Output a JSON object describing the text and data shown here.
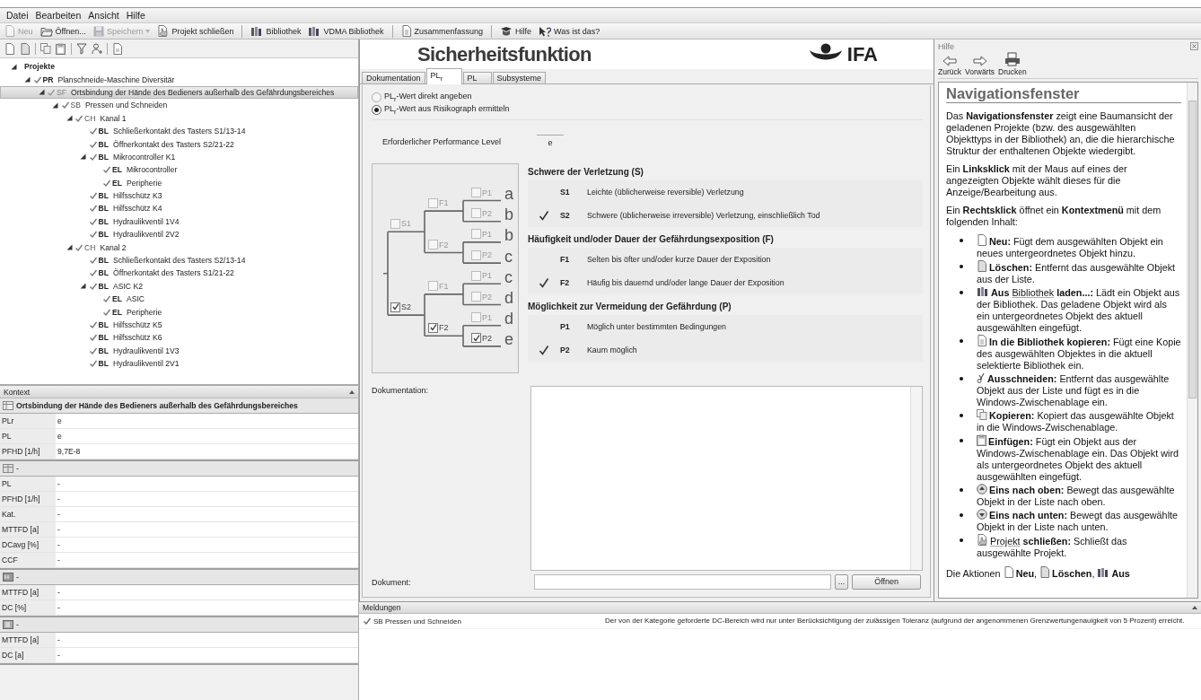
{
  "menu": [
    "Datei",
    "Bearbeiten",
    "Ansicht",
    "Hilfe"
  ],
  "toolbar": [
    {
      "kind": "button",
      "label": "Neu",
      "disabled": true
    },
    {
      "kind": "button",
      "label": "Öffnen...",
      "disabled": false
    },
    {
      "kind": "split_button",
      "label": "Speichern",
      "disabled": true
    },
    {
      "kind": "button",
      "label": "Projekt schließen",
      "disabled": false
    },
    {
      "kind": "separator"
    },
    {
      "kind": "button",
      "label": "Bibliothek",
      "disabled": false
    },
    {
      "kind": "button",
      "label": "VDMA Bibliothek",
      "disabled": false
    },
    {
      "kind": "separator"
    },
    {
      "kind": "button",
      "label": "Zusammenfassung",
      "disabled": false
    },
    {
      "kind": "separator"
    },
    {
      "kind": "button",
      "label": "Hilfe",
      "disabled": false
    },
    {
      "kind": "button",
      "label": "Was ist das?",
      "disabled": false
    }
  ],
  "tree": {
    "title": "Projekte",
    "expanded": true,
    "nodes": [
      {
        "kind": "project",
        "tag": "PR",
        "label": "Planschneide-Maschine Diversitär",
        "valid": true,
        "selected": false,
        "expanded": true,
        "children": [
          {
            "kind": "function",
            "tag": "SF",
            "label": "Ortsbindung der Hände des Bedieners außerhalb des Gefährdungsbereiches",
            "valid": true,
            "selected": true,
            "expanded": true,
            "children": [
              {
                "kind": "subsystem",
                "tag": "SB",
                "label": "Pressen und Schneiden",
                "valid": true,
                "selected": false,
                "expanded": true,
                "children": [
                  {
                    "kind": "channel",
                    "tag": "CH",
                    "label": "Kanal 1",
                    "valid": true,
                    "selected": false,
                    "expanded": true,
                    "children": [
                      {
                        "kind": "block",
                        "tag": "BL",
                        "label": "Schließerkontakt des Tasters S1/13-14",
                        "valid": true,
                        "selected": false
                      },
                      {
                        "kind": "block",
                        "tag": "BL",
                        "label": "Öffnerkontakt des Tasters S2/21-22",
                        "valid": true,
                        "selected": false
                      },
                      {
                        "kind": "block",
                        "tag": "BL",
                        "label": "Mikrocontroller K1",
                        "valid": true,
                        "selected": false,
                        "expanded": true,
                        "children": [
                          {
                            "kind": "element",
                            "tag": "EL",
                            "label": "Mikrocontroller",
                            "valid": true,
                            "selected": false
                          },
                          {
                            "kind": "element",
                            "tag": "EL",
                            "label": "Peripherie",
                            "valid": true,
                            "selected": false
                          }
                        ]
                      },
                      {
                        "kind": "block",
                        "tag": "BL",
                        "label": "Hilfsschütz K3",
                        "valid": true,
                        "selected": false
                      },
                      {
                        "kind": "block",
                        "tag": "BL",
                        "label": "Hilfsschütz K4",
                        "valid": true,
                        "selected": false
                      },
                      {
                        "kind": "block",
                        "tag": "BL",
                        "label": "Hydraulikventil 1V4",
                        "valid": true,
                        "selected": false
                      },
                      {
                        "kind": "block",
                        "tag": "BL",
                        "label": "Hydraulikventil 2V2",
                        "valid": true,
                        "selected": false
                      }
                    ]
                  },
                  {
                    "kind": "channel",
                    "tag": "CH",
                    "label": "Kanal 2",
                    "valid": true,
                    "selected": false,
                    "expanded": true,
                    "children": [
                      {
                        "kind": "block",
                        "tag": "BL",
                        "label": "Schließerkontakt des Tasters S2/13-14",
                        "valid": true,
                        "selected": false
                      },
                      {
                        "kind": "block",
                        "tag": "BL",
                        "label": "Öffnerkontakt des Tasters S1/21-22",
                        "valid": true,
                        "selected": false
                      },
                      {
                        "kind": "block",
                        "tag": "BL",
                        "label": "ASIC K2",
                        "valid": true,
                        "selected": false,
                        "expanded": true,
                        "children": [
                          {
                            "kind": "element",
                            "tag": "EL",
                            "label": "ASIC",
                            "valid": true,
                            "selected": false
                          },
                          {
                            "kind": "element",
                            "tag": "EL",
                            "label": "Peripherie",
                            "valid": true,
                            "selected": false
                          }
                        ]
                      },
                      {
                        "kind": "block",
                        "tag": "BL",
                        "label": "Hilfsschütz K5",
                        "valid": true,
                        "selected": false
                      },
                      {
                        "kind": "block",
                        "tag": "BL",
                        "label": "Hilfsschütz K6",
                        "valid": true,
                        "selected": false
                      },
                      {
                        "kind": "block",
                        "tag": "BL",
                        "label": "Hydraulikventil 1V3",
                        "valid": true,
                        "selected": false
                      },
                      {
                        "kind": "block",
                        "tag": "BL",
                        "label": "Hydraulikventil 2V1",
                        "valid": true,
                        "selected": false
                      }
                    ]
                  }
                ]
              }
            ]
          }
        ]
      }
    ]
  },
  "context": {
    "title": "Kontext",
    "sections": [
      {
        "kind": "function",
        "title": "Ortsbindung der Hände des Bedieners außerhalb des Gefährdungsbereiches",
        "rows": [
          {
            "key": "PLr",
            "value": "e"
          },
          {
            "key": "PL",
            "value": "e"
          },
          {
            "key": "PFHD [1/h]",
            "value": "9,7E-8"
          }
        ]
      },
      {
        "kind": "subsystem",
        "title": "-",
        "rows": [
          {
            "key": "PL",
            "value": "-"
          },
          {
            "key": "PFHD [1/h]",
            "value": "-"
          },
          {
            "key": "Kat.",
            "value": "-"
          },
          {
            "key": "MTTFD [a]",
            "value": "-"
          },
          {
            "key": "DCavg [%]",
            "value": "-"
          },
          {
            "key": "CCF",
            "value": "-"
          }
        ]
      },
      {
        "kind": "block",
        "title": "-",
        "rows": [
          {
            "key": "MTTFD [a]",
            "value": "-"
          },
          {
            "key": "DC [%]",
            "value": "-"
          }
        ]
      },
      {
        "kind": "element",
        "title": "-",
        "rows": [
          {
            "key": "MTTFD [a]",
            "value": "-"
          },
          {
            "key": "DC [a]",
            "value": "-"
          }
        ]
      }
    ]
  },
  "editor": {
    "title": "Sicherheitsfunktion",
    "logo_text": "IFA",
    "tabs": [
      {
        "label": "Dokumentation",
        "selected": false
      },
      {
        "label": "PL$_{r}$",
        "selected": true
      },
      {
        "label": "PL",
        "selected": false
      },
      {
        "label": "Subsysteme",
        "selected": false
      }
    ],
    "plr_mode": [
      {
        "label": "PL$_{r}$-Wert direkt angeben",
        "selected": false
      },
      {
        "label": "PL$_{r}$-Wert aus Risikograph ermitteln",
        "selected": true
      }
    ],
    "required_pl": {
      "label": "Erforderlicher Performance Level",
      "value": "e"
    },
    "risk_graph": {
      "s": [
        {
          "label": "S1",
          "checked": false
        },
        {
          "label": "S2",
          "checked": true
        }
      ],
      "f": [
        {
          "label": "F1",
          "checked": false
        },
        {
          "label": "F2",
          "checked": false
        },
        {
          "label": "F1",
          "checked": false
        },
        {
          "label": "F2",
          "checked": true
        }
      ],
      "p": [
        {
          "label": "P1",
          "checked": false
        },
        {
          "label": "P2",
          "checked": false
        },
        {
          "label": "P1",
          "checked": false
        },
        {
          "label": "P2",
          "checked": false
        },
        {
          "label": "P1",
          "checked": false
        },
        {
          "label": "P2",
          "checked": false
        },
        {
          "label": "P1",
          "checked": false
        },
        {
          "label": "P2",
          "checked": true
        }
      ],
      "outcomes": [
        "a",
        "b",
        "b",
        "c",
        "c",
        "d",
        "d",
        "e"
      ]
    },
    "criteria": [
      {
        "title": "Schwere der Verletzung (S)",
        "options": [
          {
            "code": "S1",
            "text": "Leichte (üblicherweise reversible) Verletzung",
            "selected": false
          },
          {
            "code": "S2",
            "text": "Schwere (üblicherweise irreversible) Verletzung, einschließlich Tod",
            "selected": true
          }
        ]
      },
      {
        "title": "Häufigkeit und/oder Dauer der Gefährdungsexposition (F)",
        "options": [
          {
            "code": "F1",
            "text": "Selten bis öfter und/oder kurze Dauer der Exposition",
            "selected": false
          },
          {
            "code": "F2",
            "text": "Häufig bis dauernd und/oder lange Dauer der Exposition",
            "selected": true
          }
        ]
      },
      {
        "title": "Möglichkeit zur Vermeidung der Gefährdung (P)",
        "options": [
          {
            "code": "P1",
            "text": "Möglich unter bestimmten Bedingungen",
            "selected": false
          },
          {
            "code": "P2",
            "text": "Kaum möglich",
            "selected": true
          }
        ]
      }
    ],
    "documentation_label": "Dokumentation:",
    "document": {
      "label": "Dokument:",
      "browse_button": "...",
      "open_button": "Öffnen"
    }
  },
  "help": {
    "title": "Hilfe",
    "nav": [
      {
        "label": "Zurück"
      },
      {
        "label": "Vorwärts"
      },
      {
        "label": "Drucken"
      }
    ],
    "heading": "Navigationsfenster",
    "blocks": [
      {
        "kind": "paragraph",
        "parts": [
          {
            "kind": "text",
            "text": "Das **Navigationsfenster** zeigt eine Baumansicht der geladenen Projekte (bzw. des ausgewählten Objekttyps in der Bibliothek) an, die die hierarchische Struktur der enthaltenen Objekte wiedergibt."
          }
        ]
      },
      {
        "kind": "paragraph",
        "parts": [
          {
            "kind": "text",
            "text": "Ein **Linksklick** mit der Maus auf eines der angezeigten Objekte wählt dieses für die Anzeige/Bearbeitung aus."
          }
        ]
      },
      {
        "kind": "paragraph",
        "parts": [
          {
            "kind": "text",
            "text": "Ein **Rechtsklick** öffnet ein **Kontextmenü** mit dem folgenden Inhalt:"
          }
        ]
      },
      {
        "kind": "list",
        "items": [
          {
            "parts": [
              {
                "kind": "text",
                "text": "**Neu:** Fügt dem ausgewählten Objekt ein neues untergeordnetes Objekt hinzu."
              }
            ]
          },
          {
            "parts": [
              {
                "kind": "text",
                "text": "**Löschen:** Entfernt das ausgewählte Objekt aus der Liste."
              }
            ]
          },
          {
            "parts": [
              {
                "kind": "text",
                "text": "**Aus** "
              },
              {
                "kind": "link",
                "text": "Bibliothek"
              },
              {
                "kind": "text",
                "text": " **laden...:** Lädt ein Objekt aus der Bibliothek. Das geladene Objekt wird als ein untergeordnetes Objekt des aktuell ausgewählten eingefügt."
              }
            ]
          },
          {
            "parts": [
              {
                "kind": "text",
                "text": "**In die Bibliothek kopieren:** Fügt eine Kopie des ausgewählten Objektes in die aktuell selektierte Bibliothek ein."
              }
            ]
          },
          {
            "parts": [
              {
                "kind": "text",
                "text": "**Ausschneiden:** Entfernt das ausgewählte Objekt aus der Liste und fügt es in die Windows-Zwischenablage ein."
              }
            ]
          },
          {
            "parts": [
              {
                "kind": "text",
                "text": "**Kopieren:** Kopiert das ausgewählte Objekt in die Windows-Zwischenablage."
              }
            ]
          },
          {
            "parts": [
              {
                "kind": "text",
                "text": "**Einfügen:** Fügt ein Objekt aus der Windows-Zwischenablage ein. Das Objekt wird als untergeordnetes Objekt des aktuell ausgewählten eingefügt."
              }
            ]
          },
          {
            "parts": [
              {
                "kind": "text",
                "text": "**Eins nach oben:** Bewegt das ausgewählte Objekt in der Liste nach oben."
              }
            ]
          },
          {
            "parts": [
              {
                "kind": "text",
                "text": "**Eins nach unten:** Bewegt das ausgewählte Objekt in der Liste nach unten."
              }
            ]
          },
          {
            "parts": [
              {
                "kind": "link",
                "text": "Projekt"
              },
              {
                "kind": "text",
                "text": " **schließen:** Schließt das ausgewählte Projekt."
              }
            ]
          }
        ]
      },
      {
        "kind": "paragraph",
        "parts": [
          {
            "kind": "text",
            "text": "Die Aktionen "
          },
          {
            "kind": "icon"
          },
          {
            "kind": "text",
            "text": "**Neu**, "
          },
          {
            "kind": "icon"
          },
          {
            "kind": "text",
            "text": "**Löschen**, "
          },
          {
            "kind": "icon"
          },
          {
            "kind": "text",
            "text": "**Aus**"
          }
        ]
      }
    ]
  },
  "messages": {
    "title": "Meldungen",
    "rows": [
      {
        "valid": true,
        "source": "SB Pressen und Schneiden",
        "text": "Der von der Kategorie geforderte DC-Bereich wird nur unter Berücksichtigung der zulässigen Toleranz (aufgrund der angenommenen Grenzwertungenauigkeit von 5 Prozent) erreicht."
      }
    ]
  }
}
